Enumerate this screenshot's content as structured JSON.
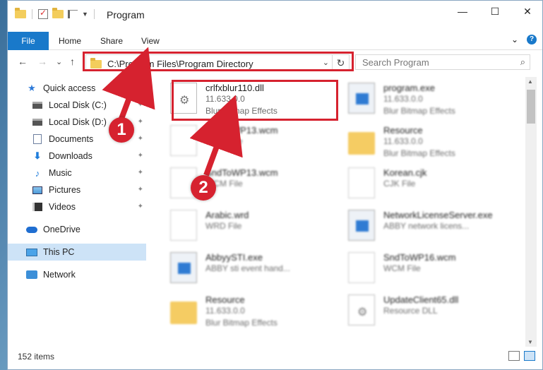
{
  "window": {
    "title": "Program",
    "controls": {
      "minimize": "—",
      "maximize": "☐",
      "close": "✕"
    }
  },
  "ribbon": {
    "tabs": [
      "File",
      "Home",
      "Share",
      "View"
    ],
    "expand": "⌄",
    "help": "?"
  },
  "nav": {
    "back": "←",
    "forward": "→",
    "recent": "⌄",
    "up": "↑",
    "address": "C:\\Program Files\\Program Directory",
    "address_dropdown": "⌄",
    "refresh": "↻",
    "search_placeholder": "Search Program",
    "search_icon": "⌕"
  },
  "sidebar": {
    "items": [
      {
        "label": "Quick access",
        "icon": "star-icon"
      },
      {
        "label": "Local Disk (C:)",
        "icon": "disk-icon",
        "pinned": true
      },
      {
        "label": "Local Disk (D:)",
        "icon": "disk-icon",
        "pinned": true
      },
      {
        "label": "Documents",
        "icon": "document-icon",
        "pinned": true
      },
      {
        "label": "Downloads",
        "icon": "download-icon",
        "pinned": true
      },
      {
        "label": "Music",
        "icon": "music-icon",
        "pinned": true
      },
      {
        "label": "Pictures",
        "icon": "pictures-icon",
        "pinned": true
      },
      {
        "label": "Videos",
        "icon": "videos-icon",
        "pinned": true
      },
      {
        "label": "OneDrive",
        "icon": "cloud-icon"
      },
      {
        "label": "This PC",
        "icon": "computer-icon",
        "selected": true
      },
      {
        "label": "Network",
        "icon": "network-icon"
      }
    ],
    "pin_glyph": "📌"
  },
  "files": [
    {
      "name": "crlfxblur110.dll",
      "line2": "11.633.0.0",
      "line3": "Blur Bitmap Effects",
      "kind": "dll",
      "highlighted": true
    },
    {
      "name": "program.exe",
      "line2": "11.633.0.0",
      "line3": "Blur Bitmap Effects",
      "kind": "exe"
    },
    {
      "name": "SndToWP13.wcm",
      "line2": "WCM File",
      "line3": "",
      "kind": "page"
    },
    {
      "name": "Resource",
      "line2": "11.633.0.0",
      "line3": "Blur Bitmap Effects",
      "kind": "folder"
    },
    {
      "name": "SndToWP13.wcm",
      "line2": "WCM File",
      "line3": "",
      "kind": "page"
    },
    {
      "name": "Korean.cjk",
      "line2": "CJK File",
      "line3": "",
      "kind": "page"
    },
    {
      "name": "Arabic.wrd",
      "line2": "WRD File",
      "line3": "",
      "kind": "page"
    },
    {
      "name": "NetworkLicenseServer.exe",
      "line2": "ABBY network licens...",
      "line3": "",
      "kind": "exe"
    },
    {
      "name": "AbbyySTI.exe",
      "line2": "ABBY sti event hand...",
      "line3": "",
      "kind": "exe"
    },
    {
      "name": "SndToWP16.wcm",
      "line2": "WCM File",
      "line3": "",
      "kind": "page"
    },
    {
      "name": "Resource",
      "line2": "11.633.0.0",
      "line3": "Blur Bitmap Effects",
      "kind": "folder"
    },
    {
      "name": "UpdateClient65.dll",
      "line2": "Resource DLL",
      "line3": "",
      "kind": "dll"
    }
  ],
  "status": {
    "item_count": "152 items"
  },
  "annotations": {
    "step1": "1",
    "step2": "2"
  },
  "colors": {
    "accent": "#1979ca",
    "highlight": "#d6222f",
    "selected": "#cde3f7"
  }
}
